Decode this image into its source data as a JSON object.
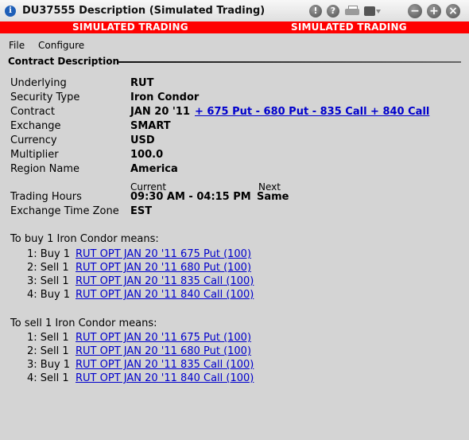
{
  "window": {
    "title": "DU37555 Description (Simulated Trading)",
    "buttons": {
      "help1": "!",
      "help2": "?",
      "minimize": "−",
      "maximize": "+",
      "close": "×"
    }
  },
  "banner": {
    "left": "SIMULATED TRADING",
    "right": "SIMULATED TRADING",
    "color": "#ff0000"
  },
  "menu": {
    "file": "File",
    "configure": "Configure"
  },
  "panel": {
    "header": "Contract Description"
  },
  "fields": {
    "underlying": {
      "label": "Underlying",
      "value": "RUT"
    },
    "security_type": {
      "label": "Security Type",
      "value": "Iron Condor"
    },
    "contract": {
      "label": "Contract",
      "value": "JAN 20 '11",
      "link": "+ 675 Put - 680 Put - 835 Call + 840 Call"
    },
    "exchange": {
      "label": "Exchange",
      "value": "SMART"
    },
    "currency": {
      "label": "Currency",
      "value": "USD"
    },
    "multiplier": {
      "label": "Multiplier",
      "value": "100.0"
    },
    "region": {
      "label": "Region Name",
      "value": "America"
    },
    "trading_hours": {
      "label": "Trading Hours",
      "current_hdr": "Current",
      "next_hdr": "Next",
      "current": "09:30 AM - 04:15 PM",
      "next": "Same"
    },
    "timezone": {
      "label": "Exchange Time Zone",
      "value": "EST"
    }
  },
  "buy": {
    "intro": "To buy 1 Iron Condor means:",
    "legs": [
      {
        "prefix": "1: Buy 1",
        "link": "RUT OPT JAN 20 '11 675 Put (100)"
      },
      {
        "prefix": "2: Sell 1",
        "link": "RUT OPT JAN 20 '11 680 Put (100)"
      },
      {
        "prefix": "3: Sell 1",
        "link": "RUT OPT JAN 20 '11 835 Call (100)"
      },
      {
        "prefix": "4: Buy 1",
        "link": "RUT OPT JAN 20 '11 840 Call (100)"
      }
    ]
  },
  "sell": {
    "intro": "To sell 1 Iron Condor means:",
    "legs": [
      {
        "prefix": "1: Sell 1",
        "link": "RUT OPT JAN 20 '11 675 Put (100)"
      },
      {
        "prefix": "2: Sell 1",
        "link": "RUT OPT JAN 20 '11 680 Put (100)"
      },
      {
        "prefix": "3: Buy 1",
        "link": "RUT OPT JAN 20 '11 835 Call (100)"
      },
      {
        "prefix": "4: Sell 1",
        "link": "RUT OPT JAN 20 '11 840 Call (100)"
      }
    ]
  }
}
